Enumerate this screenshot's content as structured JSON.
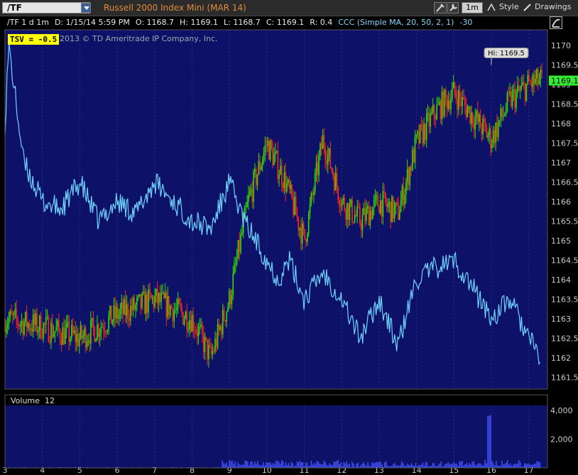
{
  "toolbar": {
    "symbol": "/TF",
    "contract": "Russell 2000 Index Mini (MAR 14)",
    "interval": "1m",
    "style_label": "Style",
    "drawings_label": "Drawings"
  },
  "info_bar": {
    "chart_label": "/TF 1 d 1m",
    "date": "D: 1/15/14 5:59 PM",
    "open": "O: 1168.7",
    "high": "H: 1169.1",
    "low": "L: 1168.7",
    "close": "C: 1169.1",
    "range": "R: 0.4",
    "indicator": "CCC (Simple MA, 20, 50, 2, 1)",
    "indicator_value": "-30"
  },
  "tsv": {
    "label": "TSV = -0.5"
  },
  "copyright": "2013 © TD Ameritrade IP Company, Inc.",
  "hi_callout": "Hi: 1169.5",
  "volume_panel": {
    "label": "Volume",
    "value": "12"
  },
  "colors": {
    "background": "#0d1167",
    "up": "#33dd00",
    "down": "#ff2a1a",
    "tsv_line": "#6fd3ff",
    "volume": "#4455ff",
    "last_price": "#33ee33"
  },
  "chart_data": {
    "type": "line",
    "title": "",
    "xlabel": "",
    "ylabel": "",
    "x_ticks": [
      "3",
      "4",
      "5",
      "6",
      "7",
      "8",
      "9",
      "10",
      "11",
      "12",
      "13",
      "14",
      "15",
      "16",
      "17"
    ],
    "ylim": [
      1161.2,
      1170.4
    ],
    "y_ticks": [
      1161.5,
      1162,
      1162.5,
      1163,
      1163.5,
      1164,
      1164.5,
      1165,
      1165.5,
      1166,
      1166.5,
      1167,
      1167.5,
      1168,
      1168.5,
      1169,
      1169.5,
      1170
    ],
    "last_price": "1169.1",
    "series": [
      {
        "type": "candlestick",
        "x": [
          3,
          4,
          5,
          6,
          7,
          8,
          8.5,
          9,
          9.5,
          10,
          10.5,
          11,
          11.5,
          12,
          12.5,
          13,
          13.5,
          14,
          14.5,
          15,
          15.5,
          16,
          16.5,
          17,
          17.3
        ],
        "close": [
          1163.0,
          1162.8,
          1162.5,
          1163.1,
          1163.5,
          1163.0,
          1162.0,
          1163.5,
          1166.0,
          1167.5,
          1166.5,
          1165.0,
          1167.6,
          1166.0,
          1165.5,
          1166.0,
          1165.7,
          1167.5,
          1168.3,
          1168.8,
          1168.2,
          1167.6,
          1168.6,
          1169.0,
          1169.1
        ]
      },
      {
        "type": "line",
        "x": [
          3,
          3.1,
          3.5,
          4,
          4.5,
          5,
          5.5,
          6,
          6.5,
          7,
          7.5,
          8,
          8.5,
          9,
          9.4,
          10,
          10.3,
          10.6,
          11,
          11.5,
          12,
          12.5,
          13,
          13.5,
          14,
          14.5,
          15,
          15.5,
          16,
          16.5,
          17,
          17.3
        ],
        "values": [
          1168.0,
          1170.0,
          1167.0,
          1166.0,
          1165.8,
          1166.5,
          1165.5,
          1166.0,
          1165.7,
          1166.5,
          1166.0,
          1165.5,
          1165.3,
          1166.5,
          1165.5,
          1164.5,
          1164.0,
          1164.5,
          1163.5,
          1164.2,
          1163.5,
          1162.5,
          1163.5,
          1162.3,
          1164.0,
          1164.3,
          1164.5,
          1163.8,
          1163.0,
          1163.5,
          1162.5,
          1162.0
        ]
      },
      {
        "type": "bar",
        "name": "Volume",
        "ylim": [
          0,
          4000
        ],
        "y_ticks": [
          "4,000",
          "2,000"
        ]
      }
    ]
  }
}
